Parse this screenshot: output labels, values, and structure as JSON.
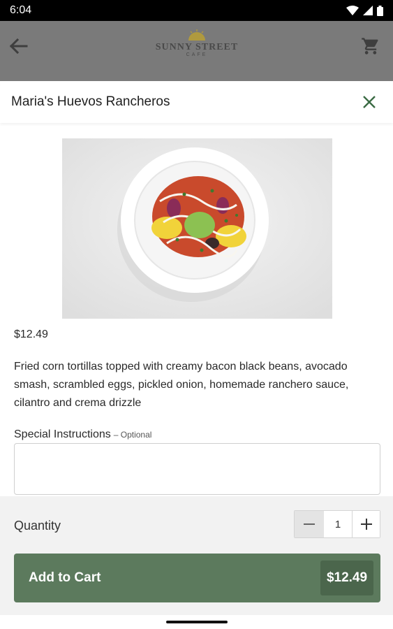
{
  "status_bar": {
    "time": "6:04"
  },
  "header": {
    "logo_text": "SUNNY STREET",
    "logo_subtext": "CAFE"
  },
  "modal": {
    "title": "Maria's Huevos Rancheros",
    "price": "$12.49",
    "description": "Fried corn tortillas topped with creamy bacon black beans, avocado smash, scrambled eggs, pickled onion, homemade ranchero sauce, cilantro and crema drizzle",
    "instructions": {
      "label": "Special Instructions",
      "optional": "– Optional",
      "value": "",
      "placeholder": ""
    },
    "quantity": {
      "label": "Quantity",
      "value": "1",
      "minus_icon": "minus-icon",
      "plus_icon": "plus-icon"
    },
    "add_button": {
      "label": "Add to Cart",
      "price": "$12.49"
    }
  },
  "colors": {
    "brand_green": "#5c7a5d",
    "brand_green_dark": "#4b664c",
    "close_icon": "#3b6b44",
    "overlay_header": "#7a7a7a"
  },
  "icons": [
    "back-arrow-icon",
    "cart-icon",
    "close-icon",
    "wifi-icon",
    "signal-icon",
    "battery-icon",
    "sun-logo-icon"
  ]
}
